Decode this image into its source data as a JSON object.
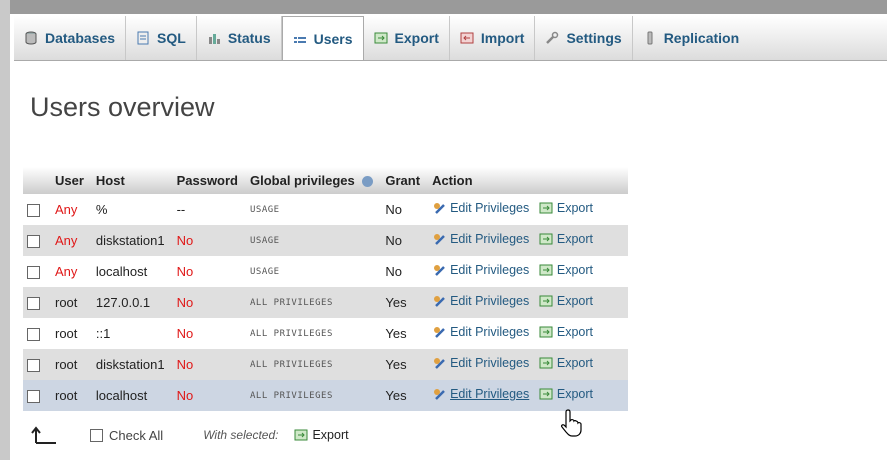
{
  "tabs": [
    {
      "label": "Databases",
      "icon": "database-icon"
    },
    {
      "label": "SQL",
      "icon": "sql-icon"
    },
    {
      "label": "Status",
      "icon": "status-icon"
    },
    {
      "label": "Users",
      "icon": "users-icon",
      "active": true
    },
    {
      "label": "Export",
      "icon": "export-icon"
    },
    {
      "label": "Import",
      "icon": "import-icon"
    },
    {
      "label": "Settings",
      "icon": "wrench-icon"
    },
    {
      "label": "Replication",
      "icon": "replication-icon"
    }
  ],
  "page_title": "Users overview",
  "table": {
    "headers": [
      "User",
      "Host",
      "Password",
      "Global privileges",
      "Grant",
      "Action"
    ],
    "rows": [
      {
        "user": "Any",
        "host": "%",
        "password": "--",
        "privileges": "USAGE",
        "grant": "No",
        "edit": "Edit Privileges",
        "export": "Export"
      },
      {
        "user": "Any",
        "host": "diskstation1",
        "password": "No",
        "privileges": "USAGE",
        "grant": "No",
        "edit": "Edit Privileges",
        "export": "Export"
      },
      {
        "user": "Any",
        "host": "localhost",
        "password": "No",
        "privileges": "USAGE",
        "grant": "No",
        "edit": "Edit Privileges",
        "export": "Export"
      },
      {
        "user": "root",
        "host": "127.0.0.1",
        "password": "No",
        "privileges": "ALL PRIVILEGES",
        "grant": "Yes",
        "edit": "Edit Privileges",
        "export": "Export"
      },
      {
        "user": "root",
        "host": "::1",
        "password": "No",
        "privileges": "ALL PRIVILEGES",
        "grant": "Yes",
        "edit": "Edit Privileges",
        "export": "Export"
      },
      {
        "user": "root",
        "host": "diskstation1",
        "password": "No",
        "privileges": "ALL PRIVILEGES",
        "grant": "Yes",
        "edit": "Edit Privileges",
        "export": "Export"
      },
      {
        "user": "root",
        "host": "localhost",
        "password": "No",
        "privileges": "ALL PRIVILEGES",
        "grant": "Yes",
        "edit": "Edit Privileges",
        "export": "Export",
        "highlighted": true
      }
    ]
  },
  "footer": {
    "check_all": "Check All",
    "with_selected": "With selected:",
    "export": "Export"
  },
  "colors": {
    "link": "#235a81",
    "no_red": "#e01818",
    "highlight": "#cdd6e3"
  }
}
